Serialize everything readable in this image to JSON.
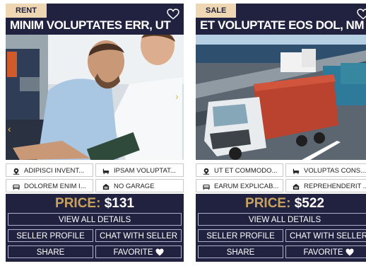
{
  "listings": [
    {
      "badge": "RENT",
      "title": "MINIM VOLUPTATES ERR, UT",
      "features": [
        "ADIPISCI INVENT...",
        "IPSAM VOLUPTAT...",
        "DOLOREM ENIM I...",
        "NO GARAGE"
      ],
      "price_label": "PRICE:",
      "price_value": "$131",
      "view_details_label": "VIEW ALL DETAILS",
      "seller_profile_label": "SELLER PROFILE",
      "chat_label": "CHAT WITH SELLER",
      "share_label": "SHARE",
      "favorite_label": "FAVORITE"
    },
    {
      "badge": "SALE",
      "title": "ET VOLUPTATE EOS DOL, NM",
      "features": [
        "UT ET COMMODO...",
        "VOLUPTAS CONS...",
        "EARUM EXPLICAB...",
        "REPREHENDERIT ..."
      ],
      "price_label": "PRICE:",
      "price_value": "$522",
      "view_details_label": "VIEW ALL DETAILS",
      "seller_profile_label": "SELLER PROFILE",
      "chat_label": "CHAT WITH SELLER",
      "share_label": "SHARE",
      "favorite_label": "FAVORITE"
    }
  ],
  "colors": {
    "navy": "#212240",
    "badge": "#efd7b3",
    "price_label": "#c7a15d"
  },
  "icons": [
    "location-pin-icon",
    "bathtub-icon",
    "bed-icon",
    "garage-icon",
    "heart-icon"
  ]
}
